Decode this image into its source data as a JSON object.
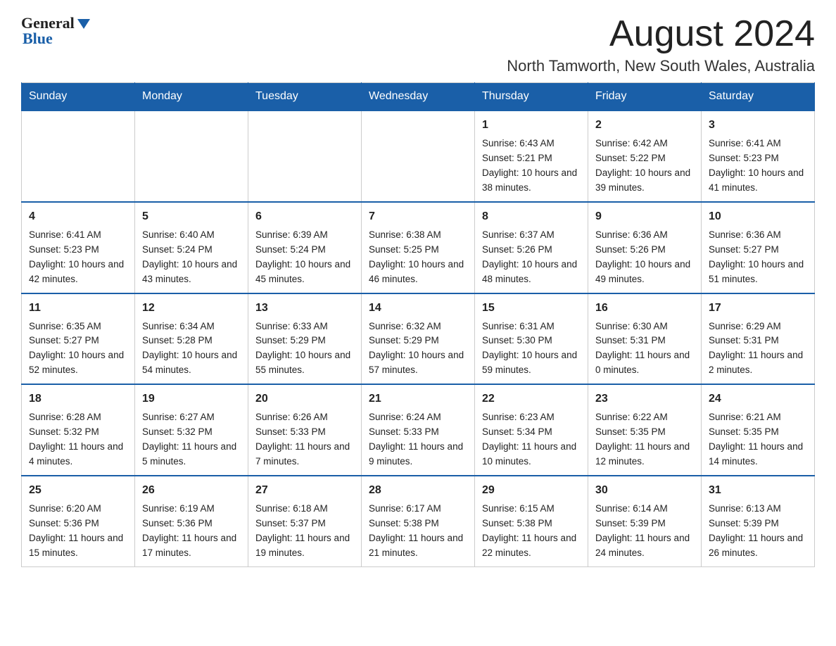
{
  "header": {
    "logo_general": "General",
    "logo_blue": "Blue",
    "month_title": "August 2024",
    "location": "North Tamworth, New South Wales, Australia"
  },
  "days_of_week": [
    "Sunday",
    "Monday",
    "Tuesday",
    "Wednesday",
    "Thursday",
    "Friday",
    "Saturday"
  ],
  "weeks": [
    [
      {
        "day": "",
        "sunrise": "",
        "sunset": "",
        "daylight": ""
      },
      {
        "day": "",
        "sunrise": "",
        "sunset": "",
        "daylight": ""
      },
      {
        "day": "",
        "sunrise": "",
        "sunset": "",
        "daylight": ""
      },
      {
        "day": "",
        "sunrise": "",
        "sunset": "",
        "daylight": ""
      },
      {
        "day": "1",
        "sunrise": "Sunrise: 6:43 AM",
        "sunset": "Sunset: 5:21 PM",
        "daylight": "Daylight: 10 hours and 38 minutes."
      },
      {
        "day": "2",
        "sunrise": "Sunrise: 6:42 AM",
        "sunset": "Sunset: 5:22 PM",
        "daylight": "Daylight: 10 hours and 39 minutes."
      },
      {
        "day": "3",
        "sunrise": "Sunrise: 6:41 AM",
        "sunset": "Sunset: 5:23 PM",
        "daylight": "Daylight: 10 hours and 41 minutes."
      }
    ],
    [
      {
        "day": "4",
        "sunrise": "Sunrise: 6:41 AM",
        "sunset": "Sunset: 5:23 PM",
        "daylight": "Daylight: 10 hours and 42 minutes."
      },
      {
        "day": "5",
        "sunrise": "Sunrise: 6:40 AM",
        "sunset": "Sunset: 5:24 PM",
        "daylight": "Daylight: 10 hours and 43 minutes."
      },
      {
        "day": "6",
        "sunrise": "Sunrise: 6:39 AM",
        "sunset": "Sunset: 5:24 PM",
        "daylight": "Daylight: 10 hours and 45 minutes."
      },
      {
        "day": "7",
        "sunrise": "Sunrise: 6:38 AM",
        "sunset": "Sunset: 5:25 PM",
        "daylight": "Daylight: 10 hours and 46 minutes."
      },
      {
        "day": "8",
        "sunrise": "Sunrise: 6:37 AM",
        "sunset": "Sunset: 5:26 PM",
        "daylight": "Daylight: 10 hours and 48 minutes."
      },
      {
        "day": "9",
        "sunrise": "Sunrise: 6:36 AM",
        "sunset": "Sunset: 5:26 PM",
        "daylight": "Daylight: 10 hours and 49 minutes."
      },
      {
        "day": "10",
        "sunrise": "Sunrise: 6:36 AM",
        "sunset": "Sunset: 5:27 PM",
        "daylight": "Daylight: 10 hours and 51 minutes."
      }
    ],
    [
      {
        "day": "11",
        "sunrise": "Sunrise: 6:35 AM",
        "sunset": "Sunset: 5:27 PM",
        "daylight": "Daylight: 10 hours and 52 minutes."
      },
      {
        "day": "12",
        "sunrise": "Sunrise: 6:34 AM",
        "sunset": "Sunset: 5:28 PM",
        "daylight": "Daylight: 10 hours and 54 minutes."
      },
      {
        "day": "13",
        "sunrise": "Sunrise: 6:33 AM",
        "sunset": "Sunset: 5:29 PM",
        "daylight": "Daylight: 10 hours and 55 minutes."
      },
      {
        "day": "14",
        "sunrise": "Sunrise: 6:32 AM",
        "sunset": "Sunset: 5:29 PM",
        "daylight": "Daylight: 10 hours and 57 minutes."
      },
      {
        "day": "15",
        "sunrise": "Sunrise: 6:31 AM",
        "sunset": "Sunset: 5:30 PM",
        "daylight": "Daylight: 10 hours and 59 minutes."
      },
      {
        "day": "16",
        "sunrise": "Sunrise: 6:30 AM",
        "sunset": "Sunset: 5:31 PM",
        "daylight": "Daylight: 11 hours and 0 minutes."
      },
      {
        "day": "17",
        "sunrise": "Sunrise: 6:29 AM",
        "sunset": "Sunset: 5:31 PM",
        "daylight": "Daylight: 11 hours and 2 minutes."
      }
    ],
    [
      {
        "day": "18",
        "sunrise": "Sunrise: 6:28 AM",
        "sunset": "Sunset: 5:32 PM",
        "daylight": "Daylight: 11 hours and 4 minutes."
      },
      {
        "day": "19",
        "sunrise": "Sunrise: 6:27 AM",
        "sunset": "Sunset: 5:32 PM",
        "daylight": "Daylight: 11 hours and 5 minutes."
      },
      {
        "day": "20",
        "sunrise": "Sunrise: 6:26 AM",
        "sunset": "Sunset: 5:33 PM",
        "daylight": "Daylight: 11 hours and 7 minutes."
      },
      {
        "day": "21",
        "sunrise": "Sunrise: 6:24 AM",
        "sunset": "Sunset: 5:33 PM",
        "daylight": "Daylight: 11 hours and 9 minutes."
      },
      {
        "day": "22",
        "sunrise": "Sunrise: 6:23 AM",
        "sunset": "Sunset: 5:34 PM",
        "daylight": "Daylight: 11 hours and 10 minutes."
      },
      {
        "day": "23",
        "sunrise": "Sunrise: 6:22 AM",
        "sunset": "Sunset: 5:35 PM",
        "daylight": "Daylight: 11 hours and 12 minutes."
      },
      {
        "day": "24",
        "sunrise": "Sunrise: 6:21 AM",
        "sunset": "Sunset: 5:35 PM",
        "daylight": "Daylight: 11 hours and 14 minutes."
      }
    ],
    [
      {
        "day": "25",
        "sunrise": "Sunrise: 6:20 AM",
        "sunset": "Sunset: 5:36 PM",
        "daylight": "Daylight: 11 hours and 15 minutes."
      },
      {
        "day": "26",
        "sunrise": "Sunrise: 6:19 AM",
        "sunset": "Sunset: 5:36 PM",
        "daylight": "Daylight: 11 hours and 17 minutes."
      },
      {
        "day": "27",
        "sunrise": "Sunrise: 6:18 AM",
        "sunset": "Sunset: 5:37 PM",
        "daylight": "Daylight: 11 hours and 19 minutes."
      },
      {
        "day": "28",
        "sunrise": "Sunrise: 6:17 AM",
        "sunset": "Sunset: 5:38 PM",
        "daylight": "Daylight: 11 hours and 21 minutes."
      },
      {
        "day": "29",
        "sunrise": "Sunrise: 6:15 AM",
        "sunset": "Sunset: 5:38 PM",
        "daylight": "Daylight: 11 hours and 22 minutes."
      },
      {
        "day": "30",
        "sunrise": "Sunrise: 6:14 AM",
        "sunset": "Sunset: 5:39 PM",
        "daylight": "Daylight: 11 hours and 24 minutes."
      },
      {
        "day": "31",
        "sunrise": "Sunrise: 6:13 AM",
        "sunset": "Sunset: 5:39 PM",
        "daylight": "Daylight: 11 hours and 26 minutes."
      }
    ]
  ]
}
